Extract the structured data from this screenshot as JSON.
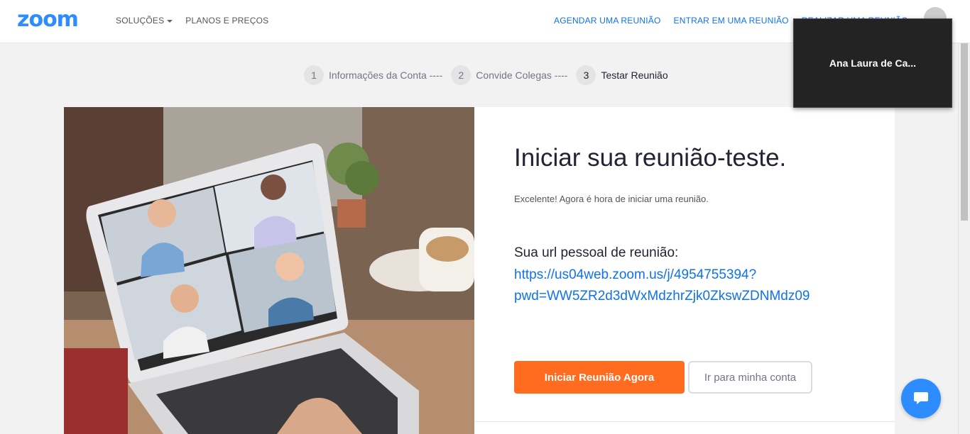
{
  "header": {
    "logo": "zoom",
    "nav_left": [
      {
        "label": "SOLUÇÕES",
        "has_dropdown": true
      },
      {
        "label": "PLANOS E PREÇOS",
        "has_dropdown": false
      }
    ],
    "nav_right": [
      {
        "label": "AGENDAR UMA REUNIÃO"
      },
      {
        "label": "ENTRAR EM UMA REUNIÃO"
      },
      {
        "label": "REALIZAR UMA REUNIÃO"
      }
    ]
  },
  "steps": [
    {
      "number": "1",
      "label": "Informações da Conta ----"
    },
    {
      "number": "2",
      "label": "Convide Colegas ----"
    },
    {
      "number": "3",
      "label": "Testar Reunião",
      "active": true
    }
  ],
  "main": {
    "title": "Iniciar sua reunião-teste.",
    "subtitle": "Excelente! Agora é hora de iniciar uma reunião.",
    "url_label": "Sua url pessoal de reunião:",
    "url_line1": "https://us04web.zoom.us/j/4954755394?",
    "url_line2": "pwd=WW5ZR2d3dWxMdzhrZjk0ZkswZDNMdz09",
    "primary_button": "Iniciar Reunião Agora",
    "secondary_button": "Ir para minha conta"
  },
  "video_window": {
    "participant_name": "Ana Laura de Ca..."
  },
  "colors": {
    "brand": "#2d8cff",
    "link": "#0e72ed",
    "cta": "#ff6c1f"
  }
}
